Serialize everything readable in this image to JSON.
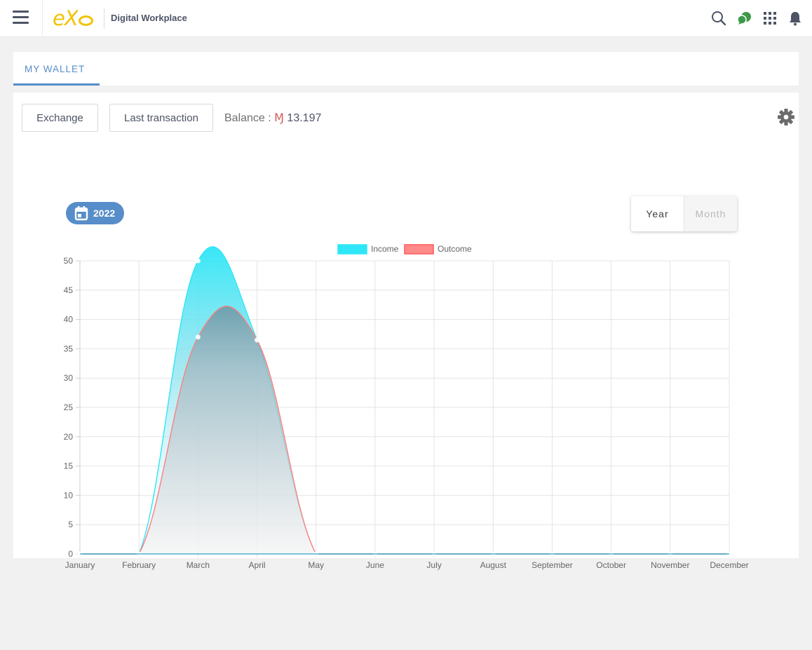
{
  "header": {
    "menu_icon": "hamburger-menu-icon",
    "logo_text": "eXo",
    "app_title": "Digital Workplace",
    "icons": [
      "search-icon",
      "chat-icon",
      "apps-grid-icon",
      "notification-bell-icon"
    ],
    "chat_color": "#3e9a4a"
  },
  "tabs": [
    {
      "label": "MY WALLET",
      "active": true
    }
  ],
  "wallet": {
    "exchange_label": "Exchange",
    "last_transaction_label": "Last transaction",
    "balance_label": "Balance : ",
    "balance_currency": "Ɱ",
    "balance_value": "13.197",
    "settings_icon": "gear-icon"
  },
  "period": {
    "year_chip": "2022",
    "calendar_icon": "calendar-icon",
    "toggle_year": "Year",
    "toggle_month": "Month",
    "selected": "Year"
  },
  "colors": {
    "accent": "#578dc9",
    "income": "#2ee6f7",
    "outcome": "#ff7f7f"
  },
  "chart_data": {
    "type": "area",
    "categories": [
      "January",
      "February",
      "March",
      "April",
      "May",
      "June",
      "July",
      "August",
      "September",
      "October",
      "November",
      "December"
    ],
    "series": [
      {
        "name": "Income",
        "values": [
          0,
          0,
          50,
          36.5,
          0,
          0,
          0,
          0,
          0,
          0,
          0,
          0
        ],
        "color": "#2ee6f7"
      },
      {
        "name": "Outcome",
        "values": [
          0,
          0,
          37,
          36.5,
          0,
          0,
          0,
          0,
          0,
          0,
          0,
          0
        ],
        "color": "#ff7f7f"
      }
    ],
    "yticks": [
      "0",
      "5",
      "10",
      "15",
      "20",
      "25",
      "30",
      "35",
      "40",
      "45",
      "50"
    ],
    "ylim": [
      0,
      50
    ],
    "legend_position": "top",
    "grid": true,
    "smooth": true
  }
}
